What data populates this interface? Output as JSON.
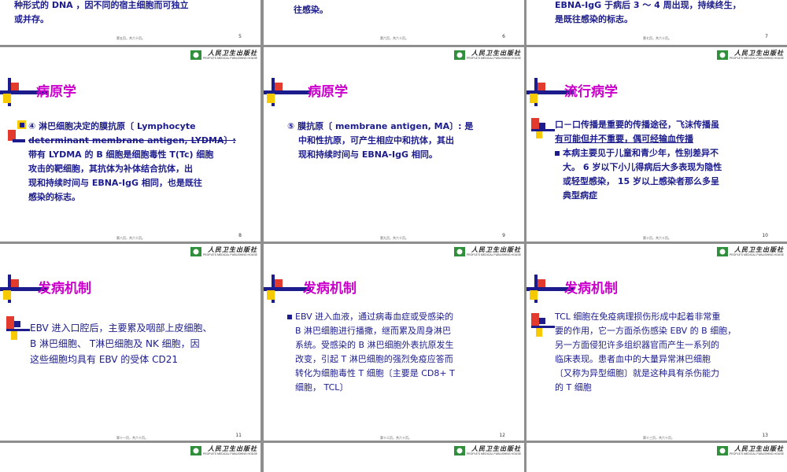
{
  "logo": {
    "cn": "人民卫生出版社",
    "en": "PEOPLE'S MEDICAL PUBLISHING HOUSE",
    "mark_color": "#2f8f3a"
  },
  "colors": {
    "title": "#cc00cc",
    "body": "#1c1c8c",
    "bar_blue": "#1c1c8c",
    "bar_red": "#e23b2e",
    "bar_yellow": "#f6c900"
  },
  "row0": [
    {
      "lines": [
        "种形式的 DNA ，因不同的宿主细胞而可独立",
        "或并存。"
      ],
      "footer": "第五页，共六十页。",
      "num": "5"
    },
    {
      "lines": [
        "往感染。"
      ],
      "footer": "第六页，共六十页。",
      "num": "6"
    },
    {
      "lines": [
        "EBNA-IgG 于病后 3 ～ 4 周出现，持续终生，",
        "是既往感染的标志。"
      ],
      "footer": "第七页，共六十页。",
      "num": "7"
    }
  ],
  "row1": [
    {
      "title": "病原学",
      "lines": [
        "④ 淋巴细胞决定的膜抗原〔 Lymphocyte",
        "determinant membrane antigen, LYDMA〕:",
        "带有 LYDMA 的 B 细胞是细胞毒性 T(Tc) 细胞",
        "攻击的靶细胞，其抗体为补体结合抗体，出",
        "现和持续时间与 EBNA-IgG 相同，也是既往",
        "感染的标志。"
      ],
      "footer": "第八页，共六十页。",
      "num": "8"
    },
    {
      "title": "病原学",
      "lines": [
        "⑤ 膜抗原〔 membrane antigen, MA〕: 是",
        "中和性抗原，可产生相应中和抗体，其出",
        "现和持续时间与 EBNA-IgG 相同。"
      ],
      "footer": "第九页，共六十页。",
      "num": "9"
    },
    {
      "title": "流行病学",
      "lines": [
        "口－口传播是重要的传播途径，飞沫传播虽",
        "有可能但并不重要，偶可经输血传播",
        "本病主要见于儿童和青少年，性别差异不",
        "大。 6 岁以下小儿得病后大多表现为隐性",
        "或轻型感染， 15 岁以上感染者那么多呈",
        "典型病症"
      ],
      "footer": "第十页，共六十页。",
      "num": "10"
    }
  ],
  "row2": [
    {
      "title": "发病机制",
      "lines": [
        "EBV 进入口腔后，主要累及咽部上皮细胞、",
        "B 淋巴细胞、 T淋巴细胞及 NK 细胞，因",
        "这些细胞均具有 EBV 的受体 CD21"
      ],
      "footer": "第十一页，共六十页。",
      "num": "11"
    },
    {
      "title": "发病机制",
      "lines": [
        "EBV 进入血液，通过病毒血症或受感染的",
        "B 淋巴细胞进行播撒，继而累及周身淋巴",
        "系统。受感染的 B 淋巴细胞外表抗原发生",
        "改变，引起 T 淋巴细胞的强烈免疫应答而",
        "转化为细胞毒性 T 细胞〔主要是 CD8+ T",
        "细胞， TCL〕"
      ],
      "footer": "第十二页，共六十页。",
      "num": "12"
    },
    {
      "title": "发病机制",
      "lines": [
        "TCL 细胞在免疫病理损伤形成中起着非常重",
        "要的作用，它一方面杀伤感染 EBV 的 B 细胞，",
        "另一方面侵犯许多组织器官而产生一系列的",
        "临床表现。患者血中的大量异常淋巴细胞",
        "〔又称为异型细胞〕就是这种具有杀伤能力",
        "的 T 细胞"
      ],
      "footer": "第十三页，共六十页。",
      "num": "13"
    }
  ]
}
